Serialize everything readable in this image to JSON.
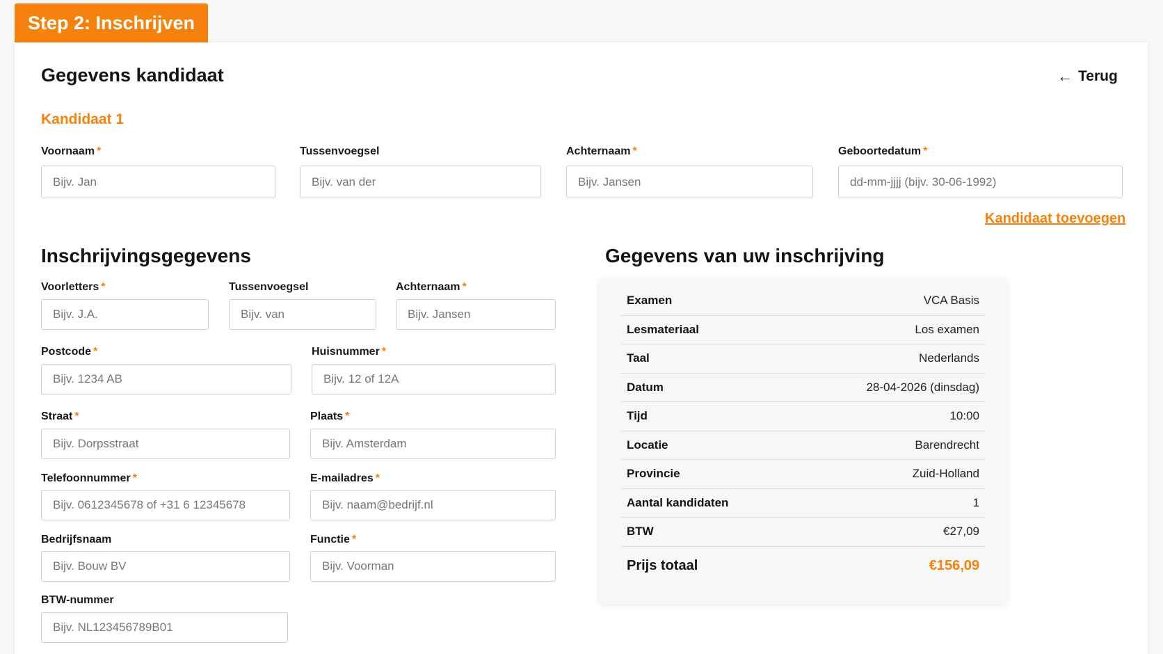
{
  "step": {
    "label": "Step 2: Inschrijven"
  },
  "candidate_section": {
    "title": "Gegevens kandidaat",
    "back_label": "Terug",
    "candidate_label": "Kandidaat 1",
    "fields": {
      "voornaam": {
        "label": "Voornaam",
        "placeholder": "Bijv. Jan"
      },
      "tussenvoegsel": {
        "label": "Tussenvoegsel",
        "placeholder": "Bijv. van der"
      },
      "achternaam": {
        "label": "Achternaam",
        "placeholder": "Bijv. Jansen"
      },
      "geboortedatum": {
        "label": "Geboortedatum",
        "placeholder": "dd-mm-jjjj (bijv. 30-06-1992)"
      }
    },
    "add_candidate_label": "Kandidaat toevoegen"
  },
  "registration_section": {
    "title": "Inschrijvingsgegevens",
    "fields": {
      "voorletters": {
        "label": "Voorletters",
        "placeholder": "Bijv. J.A."
      },
      "tussenvoegsel": {
        "label": "Tussenvoegsel",
        "placeholder": "Bijv. van"
      },
      "achternaam": {
        "label": "Achternaam",
        "placeholder": "Bijv. Jansen"
      },
      "postcode": {
        "label": "Postcode",
        "placeholder": "Bijv. 1234 AB"
      },
      "huisnummer": {
        "label": "Huisnummer",
        "placeholder": "Bijv. 12 of 12A"
      },
      "straat": {
        "label": "Straat",
        "placeholder": "Bijv. Dorpsstraat"
      },
      "plaats": {
        "label": "Plaats",
        "placeholder": "Bijv. Amsterdam"
      },
      "telefoonnummer": {
        "label": "Telefoonnummer",
        "placeholder": "Bijv. 0612345678 of +31 6 12345678"
      },
      "email": {
        "label": "E-mailadres",
        "placeholder": "Bijv. naam@bedrijf.nl"
      },
      "bedrijfsnaam": {
        "label": "Bedrijfsnaam",
        "placeholder": "Bijv. Bouw BV"
      },
      "functie": {
        "label": "Functie",
        "placeholder": "Bijv. Voorman"
      },
      "btw_nummer": {
        "label": "BTW-nummer",
        "placeholder": "Bijv. NL123456789B01"
      }
    }
  },
  "summary_section": {
    "title": "Gegevens van uw inschrijving",
    "rows": [
      {
        "key": "Examen",
        "value": "VCA Basis"
      },
      {
        "key": "Lesmateriaal",
        "value": "Los examen"
      },
      {
        "key": "Taal",
        "value": "Nederlands"
      },
      {
        "key": "Datum",
        "value": "28-04-2026 (dinsdag)"
      },
      {
        "key": "Tijd",
        "value": "10:00"
      },
      {
        "key": "Locatie",
        "value": "Barendrecht"
      },
      {
        "key": "Provincie",
        "value": "Zuid-Holland"
      },
      {
        "key": "Aantal kandidaten",
        "value": "1"
      },
      {
        "key": "BTW",
        "value": "€27,09"
      }
    ],
    "total": {
      "key": "Prijs totaal",
      "value": "€156,09"
    }
  },
  "colors": {
    "accent": "#f5820d",
    "required_marker": "#f5820d"
  },
  "icons": {
    "back": "arrow-left-icon"
  }
}
